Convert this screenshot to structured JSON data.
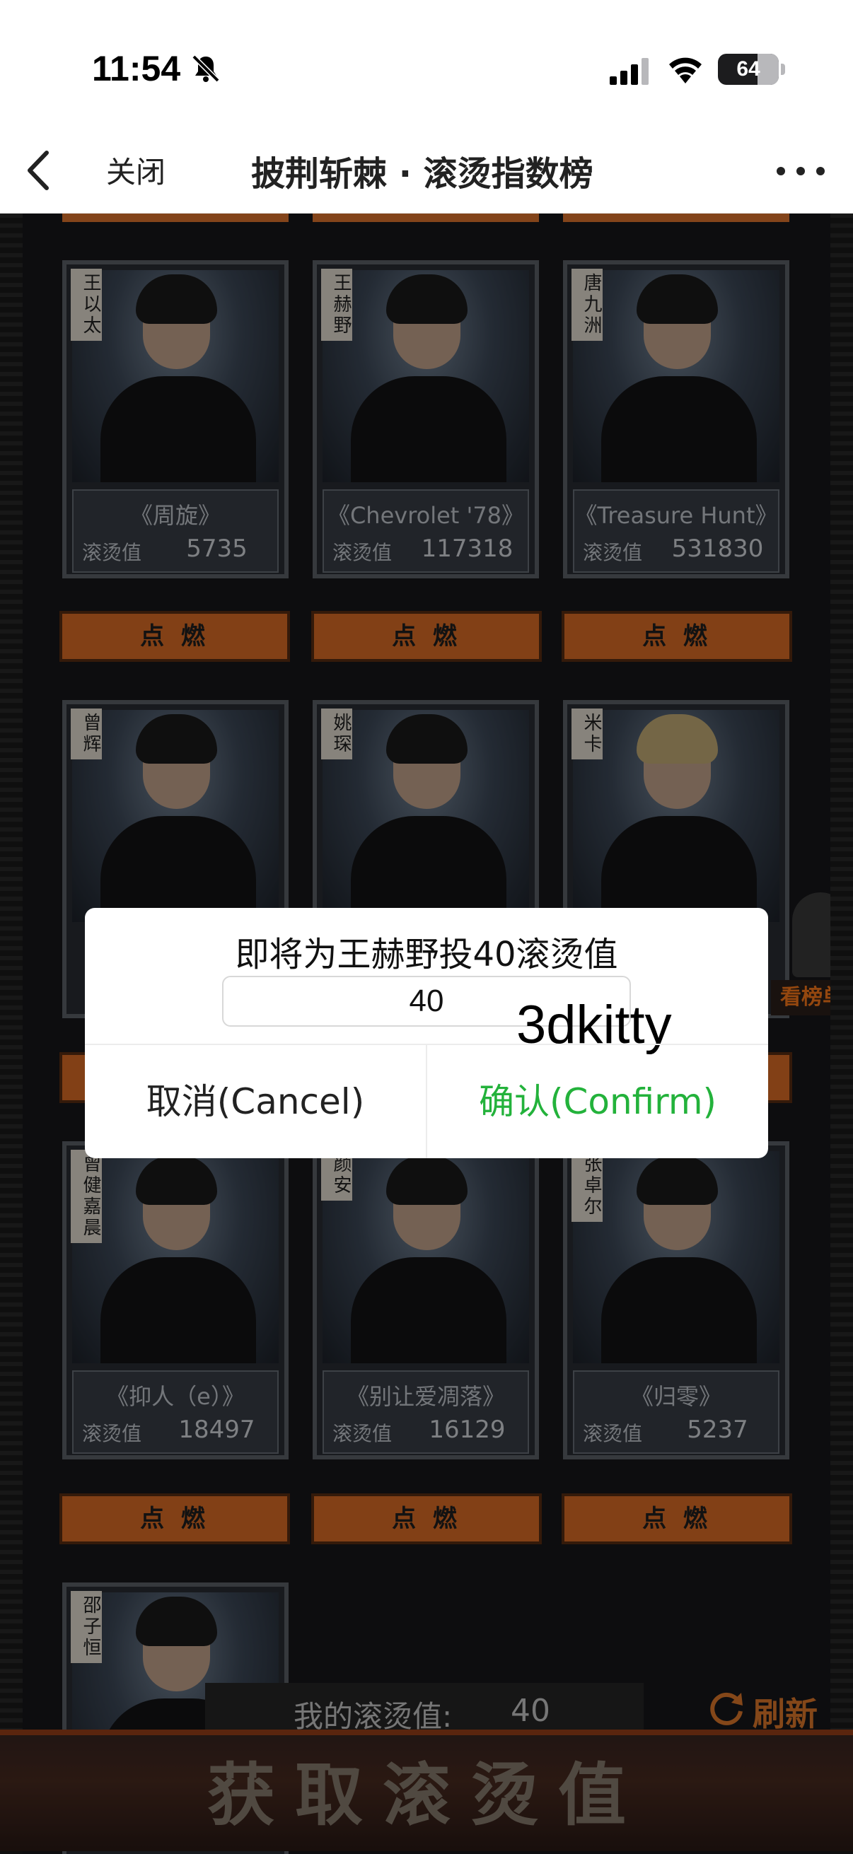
{
  "status_bar": {
    "time": "11:54",
    "battery": "64",
    "battery_level": 0.64
  },
  "nav": {
    "close_label": "关闭",
    "title": "披荆斩棘 · 滚烫指数榜"
  },
  "cards": [
    {
      "name": "王以太",
      "song": "《周旋》",
      "heat_label": "滚烫值",
      "heat": "5735"
    },
    {
      "name": "王赫野",
      "song": "《Chevrolet '78》",
      "heat_label": "滚烫值",
      "heat": "117318"
    },
    {
      "name": "唐九洲",
      "song": "《Treasure Hunt》",
      "heat_label": "滚烫值",
      "heat": "531830"
    },
    {
      "name": "曾辉"
    },
    {
      "name": "姚琛"
    },
    {
      "name": "米卡"
    },
    {
      "name": "曾健嘉晨",
      "song": "《抑人（e）》",
      "heat_label": "滚烫值",
      "heat": "18497"
    },
    {
      "name": "颜安",
      "song": "《别让爱凋落》",
      "heat_label": "滚烫值",
      "heat": "16129"
    },
    {
      "name": "张卓尔",
      "song": "《归零》",
      "heat_label": "滚烫值",
      "heat": "5237"
    },
    {
      "name": "邵子恒"
    }
  ],
  "vote_button_label": "点 燃",
  "rank_label": "看榜单",
  "my_heat": {
    "label": "我的滚烫值:",
    "value": "40"
  },
  "refresh_label": "刷新",
  "get_heat_label": "获取滚烫值",
  "dialog": {
    "title": "即将为王赫野投40滚烫值",
    "input_value": "40",
    "cancel_label": "取消(Cancel)",
    "confirm_label": "确认(Confirm)"
  },
  "watermark": "3dkitty",
  "colors": {
    "accent": "#e06f26",
    "confirm": "#23b23b"
  }
}
